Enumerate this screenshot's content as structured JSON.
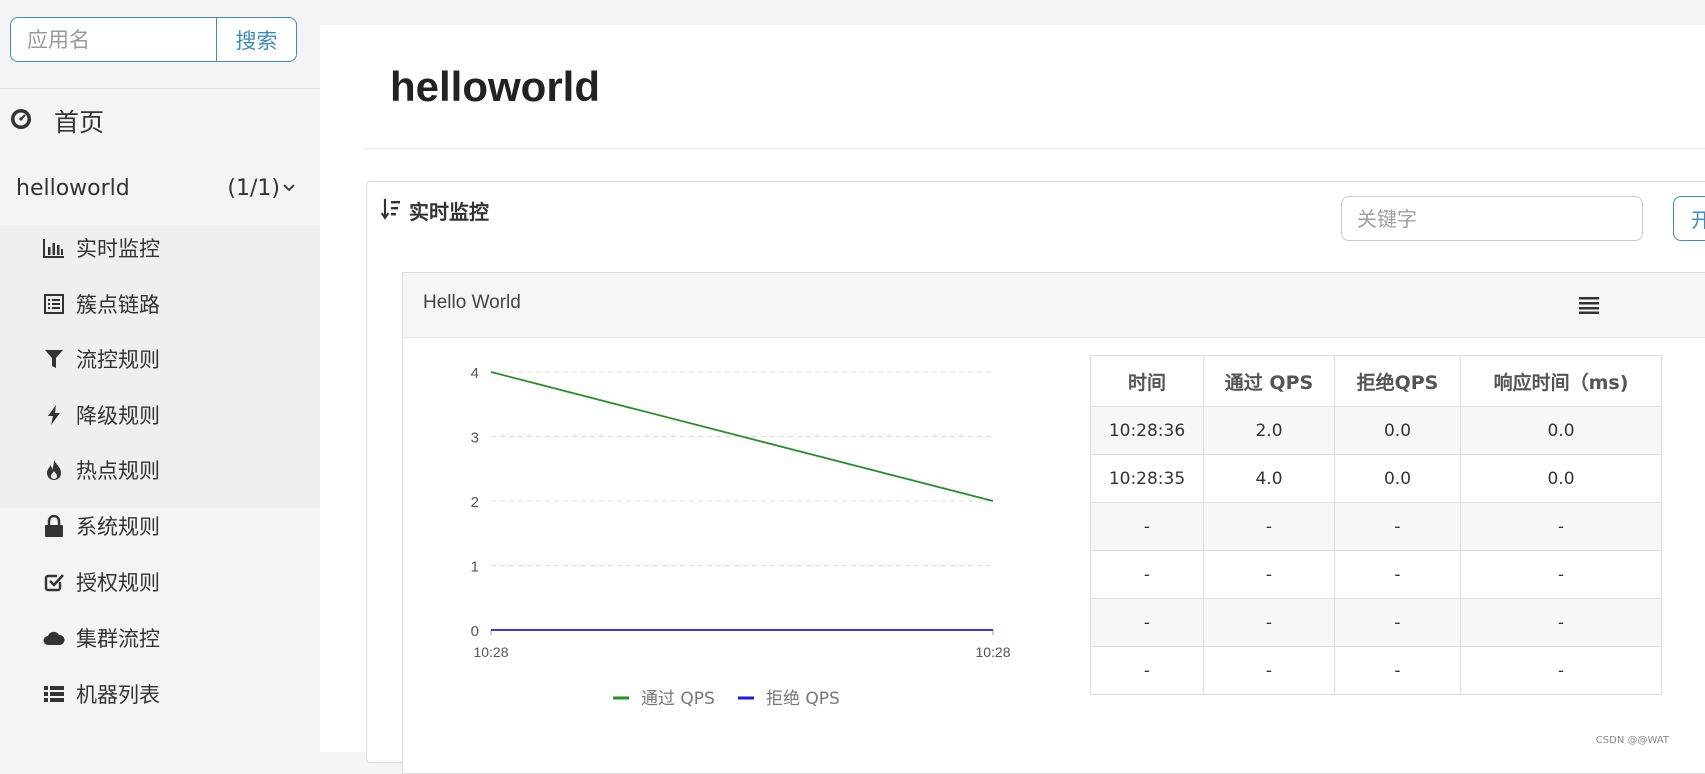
{
  "sidebar": {
    "search": {
      "placeholder": "应用名",
      "button_label": "搜索"
    },
    "home_label": "首页",
    "app": {
      "name": "helloworld",
      "count": "(1/1)"
    },
    "items": [
      {
        "label": "实时监控",
        "icon": "bar-chart-icon"
      },
      {
        "label": "簇点链路",
        "icon": "list-icon"
      },
      {
        "label": "流控规则",
        "icon": "filter-icon"
      },
      {
        "label": "降级规则",
        "icon": "bolt-icon"
      },
      {
        "label": "热点规则",
        "icon": "fire-icon"
      },
      {
        "label": "系统规则",
        "icon": "lock-icon"
      },
      {
        "label": "授权规则",
        "icon": "check-square-icon"
      },
      {
        "label": "集群流控",
        "icon": "cloud-icon"
      },
      {
        "label": "机器列表",
        "icon": "list-icon"
      }
    ]
  },
  "main": {
    "title": "helloworld",
    "panel": {
      "title": "实时监控",
      "keyword_placeholder": "关键字",
      "refresh_label": "开"
    },
    "card": {
      "title": "Hello World",
      "table": {
        "headers": [
          "时间",
          "通过 QPS",
          "拒绝QPS",
          "响应时间（ms)"
        ],
        "rows": [
          [
            "10:28:36",
            "2.0",
            "0.0",
            "0.0"
          ],
          [
            "10:28:35",
            "4.0",
            "0.0",
            "0.0"
          ],
          [
            "-",
            "-",
            "-",
            "-"
          ],
          [
            "-",
            "-",
            "-",
            "-"
          ],
          [
            "-",
            "-",
            "-",
            "-"
          ],
          [
            "-",
            "-",
            "-",
            "-"
          ]
        ]
      }
    }
  },
  "chart_data": {
    "type": "line",
    "x": [
      "10:28",
      "10:28"
    ],
    "ylim": [
      0,
      4
    ],
    "yticks": [
      "0",
      "1",
      "2",
      "3",
      "4"
    ],
    "grid": true,
    "legend_position": "bottom",
    "series": [
      {
        "name": "通过 QPS",
        "values": [
          4,
          2
        ],
        "color": "#2a8c2a"
      },
      {
        "name": "拒绝 QPS",
        "values": [
          0,
          0
        ],
        "color": "#1a1ae0"
      }
    ]
  },
  "watermark": "CSDN @@WAT"
}
